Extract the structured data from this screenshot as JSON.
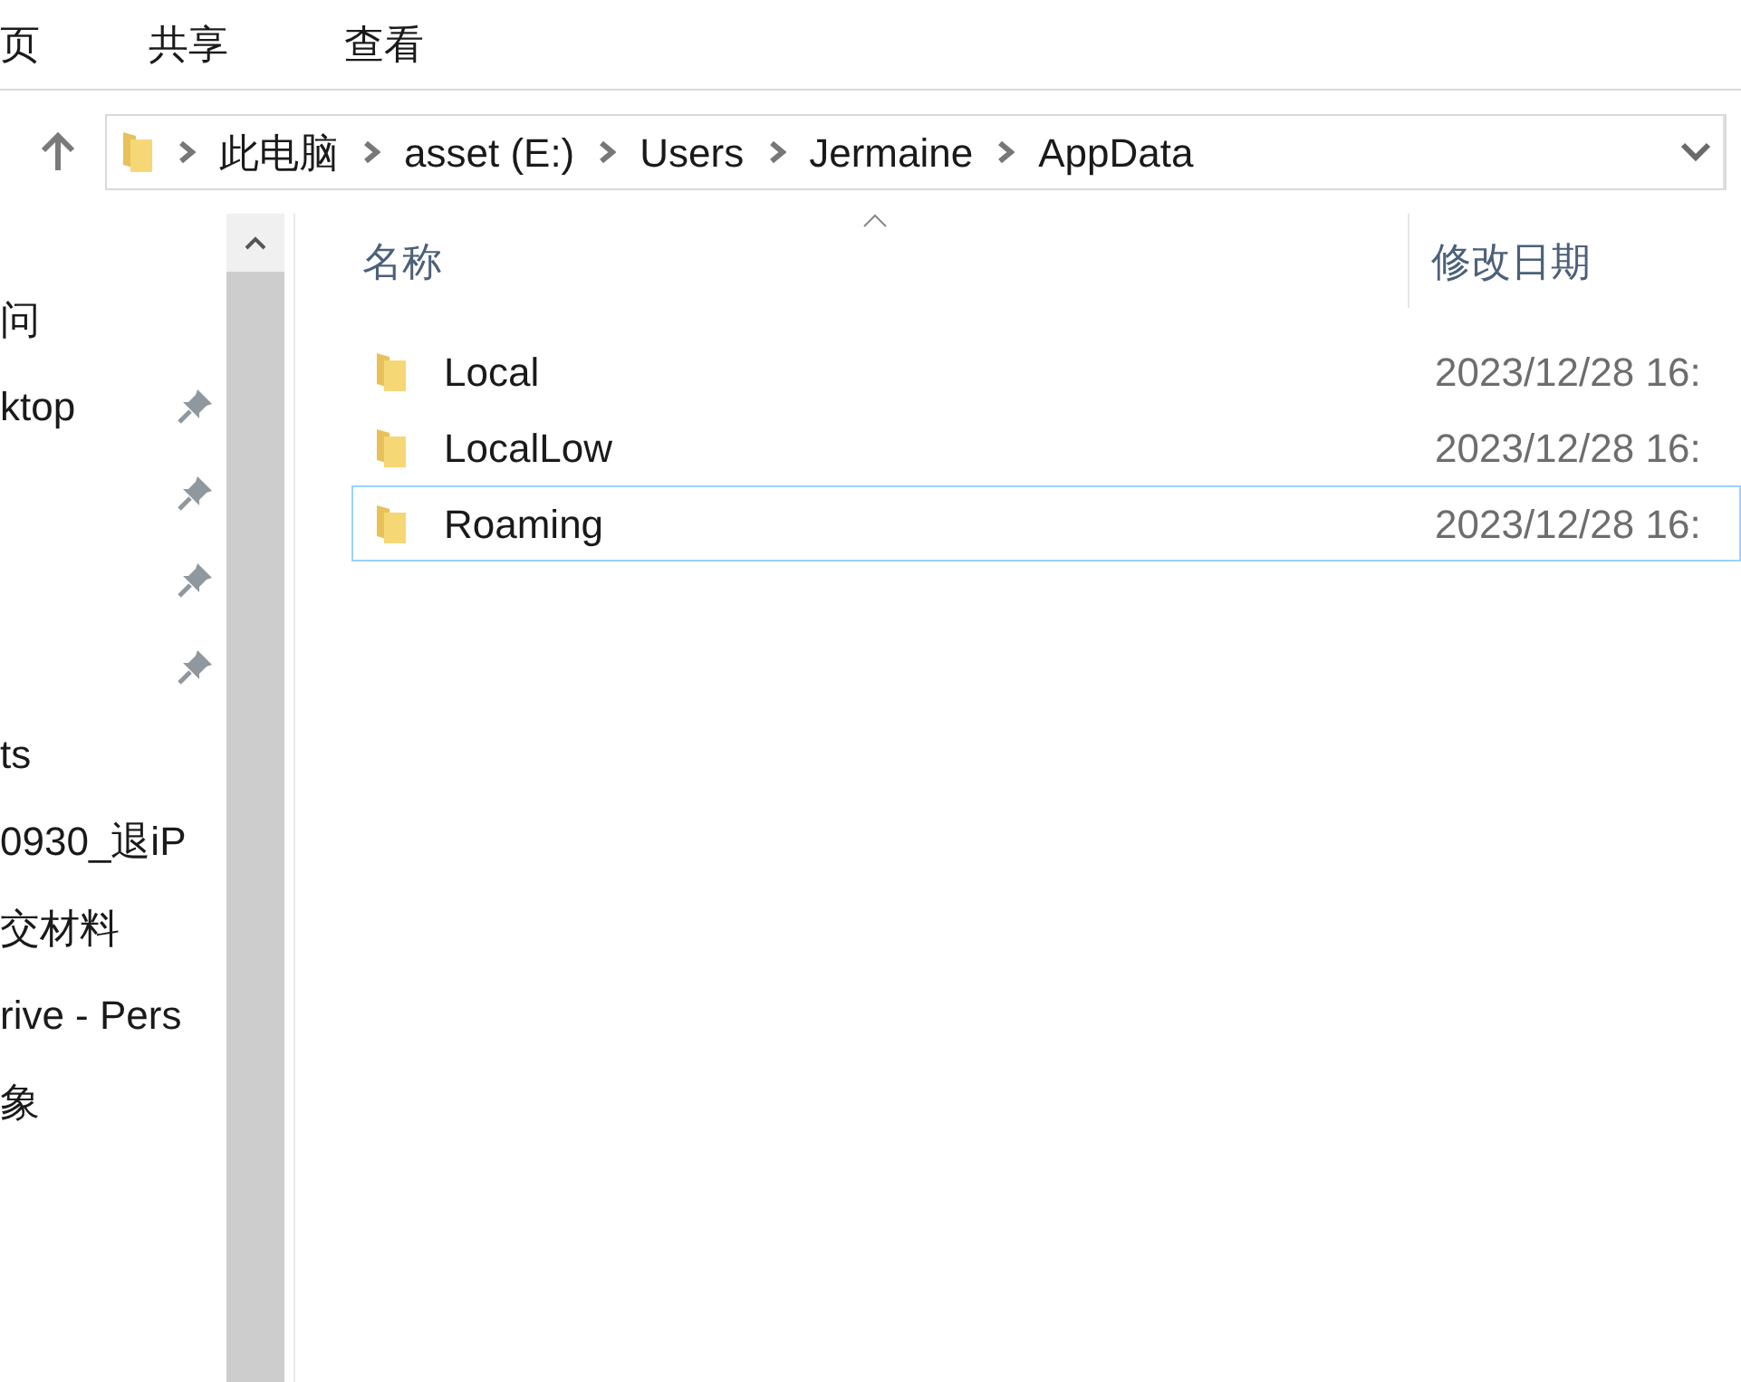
{
  "ribbon_tabs": [
    {
      "label": "页"
    },
    {
      "label": "共享"
    },
    {
      "label": "查看"
    }
  ],
  "address_bar": {
    "segments": [
      "此电脑",
      "asset (E:)",
      "Users",
      "Jermaine",
      "AppData"
    ]
  },
  "sidebar": {
    "items": [
      {
        "label": "问",
        "pinned": false
      },
      {
        "label": "ktop",
        "pinned": true
      },
      {
        "pinned": true
      },
      {
        "pinned": true
      },
      {
        "pinned": true
      },
      {
        "label": "ts",
        "pinned": false
      },
      {
        "label": "0930_退iP",
        "pinned": false
      },
      {
        "label": "交材料",
        "pinned": false
      },
      {
        "label": "rive - Pers",
        "pinned": false
      },
      {
        "label": "象",
        "pinned": false
      }
    ]
  },
  "file_list": {
    "columns": [
      "名称",
      "修改日期"
    ],
    "rows": [
      {
        "name": "Local",
        "modified": "2023/12/28 16:",
        "focused": false
      },
      {
        "name": "LocalLow",
        "modified": "2023/12/28 16:",
        "focused": false
      },
      {
        "name": "Roaming",
        "modified": "2023/12/28 16:",
        "focused": true
      }
    ]
  }
}
